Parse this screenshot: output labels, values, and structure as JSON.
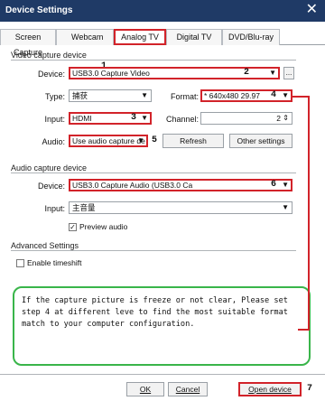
{
  "window": {
    "title": "Device Settings",
    "close_icon": "close-icon"
  },
  "tabs": [
    {
      "label": "Screen Capture"
    },
    {
      "label": "Webcam"
    },
    {
      "label": "Analog TV"
    },
    {
      "label": "Digital TV"
    },
    {
      "label": "DVD/Blu-ray"
    }
  ],
  "markers": {
    "m1": "1",
    "m2": "2",
    "m3": "3",
    "m4": "4",
    "m5": "5",
    "m6": "6",
    "m7": "7"
  },
  "video": {
    "group_title": "Video capture device",
    "device_label": "Device:",
    "device_value": "USB3.0 Capture Video",
    "more_button": "...",
    "type_label": "Type:",
    "type_value": "捕获",
    "format_label": "Format:",
    "format_value": "* 640x480 29.97",
    "input_label": "Input:",
    "input_value": "HDMI",
    "channel_label": "Channel:",
    "channel_value": "2",
    "audio_label": "Audio:",
    "audio_value": "Use audio capture de",
    "refresh_button": "Refresh",
    "other_button": "Other settings"
  },
  "audio": {
    "group_title": "Audio capture device",
    "device_label": "Device:",
    "device_value": "USB3.0 Capture Audio (USB3.0 Ca",
    "input_label": "Input:",
    "input_value": "主音量",
    "preview_label": "Preview audio",
    "preview_checked": true
  },
  "advanced": {
    "group_title": "Advanced Settings",
    "timeshift_label": "Enable timeshift",
    "timeshift_checked": false
  },
  "note": "If the capture picture is freeze or not clear, Please set step 4 at different leve to find the most suitable format match to your computer configuration.",
  "buttons": {
    "ok": "OK",
    "cancel": "Cancel",
    "open_device": "Open device"
  },
  "colors": {
    "title_bar": "#1f3a66",
    "highlight": "#d2232a",
    "note_border": "#39b54a"
  }
}
